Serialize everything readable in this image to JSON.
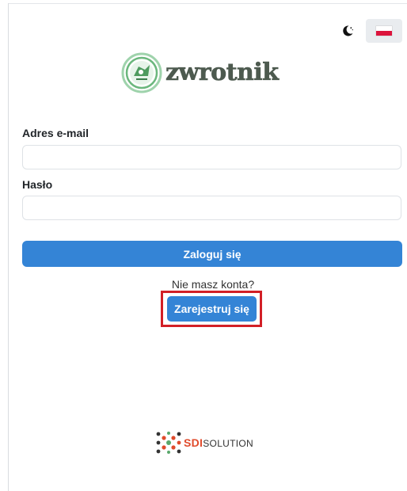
{
  "header": {
    "theme_icon": "moon-icon",
    "language_icon": "poland-flag-icon"
  },
  "brand": {
    "logo_text": "zwrotnik",
    "accent_color": "#5aa86c"
  },
  "form": {
    "email_label": "Adres e-mail",
    "email_value": "",
    "password_label": "Hasło",
    "password_value": "",
    "login_button": "Zaloguj się",
    "primary_color": "#3484d6"
  },
  "register": {
    "prompt": "Nie masz konta?",
    "button": "Zarejestruj się",
    "highlight_color": "#d21f26"
  },
  "footer": {
    "partner_logo_sdi": "SDI",
    "partner_logo_solution": "SOLUTION"
  }
}
